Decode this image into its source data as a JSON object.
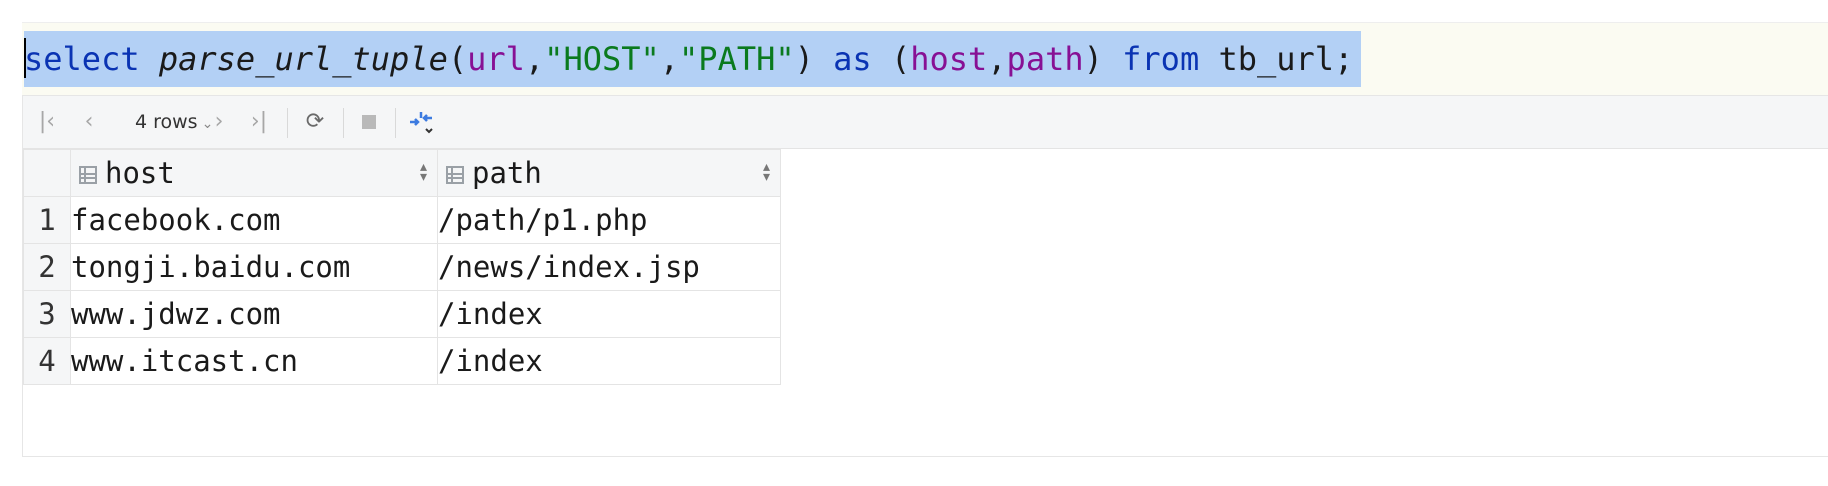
{
  "editor": {
    "tokens": [
      {
        "text": "select",
        "cls": "kw"
      },
      {
        "text": " ",
        "cls": "plain"
      },
      {
        "text": "parse_url_tuple",
        "cls": "fn"
      },
      {
        "text": "(",
        "cls": "plain"
      },
      {
        "text": "url",
        "cls": "col"
      },
      {
        "text": ",",
        "cls": "plain"
      },
      {
        "text": "\"HOST\"",
        "cls": "str"
      },
      {
        "text": ",",
        "cls": "plain"
      },
      {
        "text": "\"PATH\"",
        "cls": "str"
      },
      {
        "text": ") ",
        "cls": "plain"
      },
      {
        "text": "as",
        "cls": "kw"
      },
      {
        "text": " (",
        "cls": "plain"
      },
      {
        "text": "host",
        "cls": "col"
      },
      {
        "text": ",",
        "cls": "plain"
      },
      {
        "text": "path",
        "cls": "col"
      },
      {
        "text": ") ",
        "cls": "plain"
      },
      {
        "text": "from",
        "cls": "kw"
      },
      {
        "text": " tb_url;",
        "cls": "plain"
      }
    ],
    "colors": {
      "keyword": "#0a33b3",
      "string": "#0a7a1e",
      "column": "#871094",
      "selection": "#b3d0f5"
    }
  },
  "toolbar": {
    "first_icon": "first-page-icon",
    "prev_icon": "previous-page-icon",
    "rows_label": "4 rows",
    "rows_chevron": "chevron-down-icon",
    "next_icon": "next-page-icon",
    "last_icon": "last-page-icon",
    "refresh_icon": "refresh-icon",
    "stop_icon": "stop-icon",
    "layout_icon": "compare-arrows-icon"
  },
  "grid": {
    "columns": [
      {
        "label": "host",
        "icon": "column-icon"
      },
      {
        "label": "path",
        "icon": "column-icon"
      }
    ],
    "rows": [
      {
        "num": "1",
        "host": "facebook.com",
        "path": "/path/p1.php"
      },
      {
        "num": "2",
        "host": "tongji.baidu.com",
        "path": "/news/index.jsp"
      },
      {
        "num": "3",
        "host": "www.jdwz.com",
        "path": "/index"
      },
      {
        "num": "4",
        "host": "www.itcast.cn",
        "path": "/index"
      }
    ]
  }
}
